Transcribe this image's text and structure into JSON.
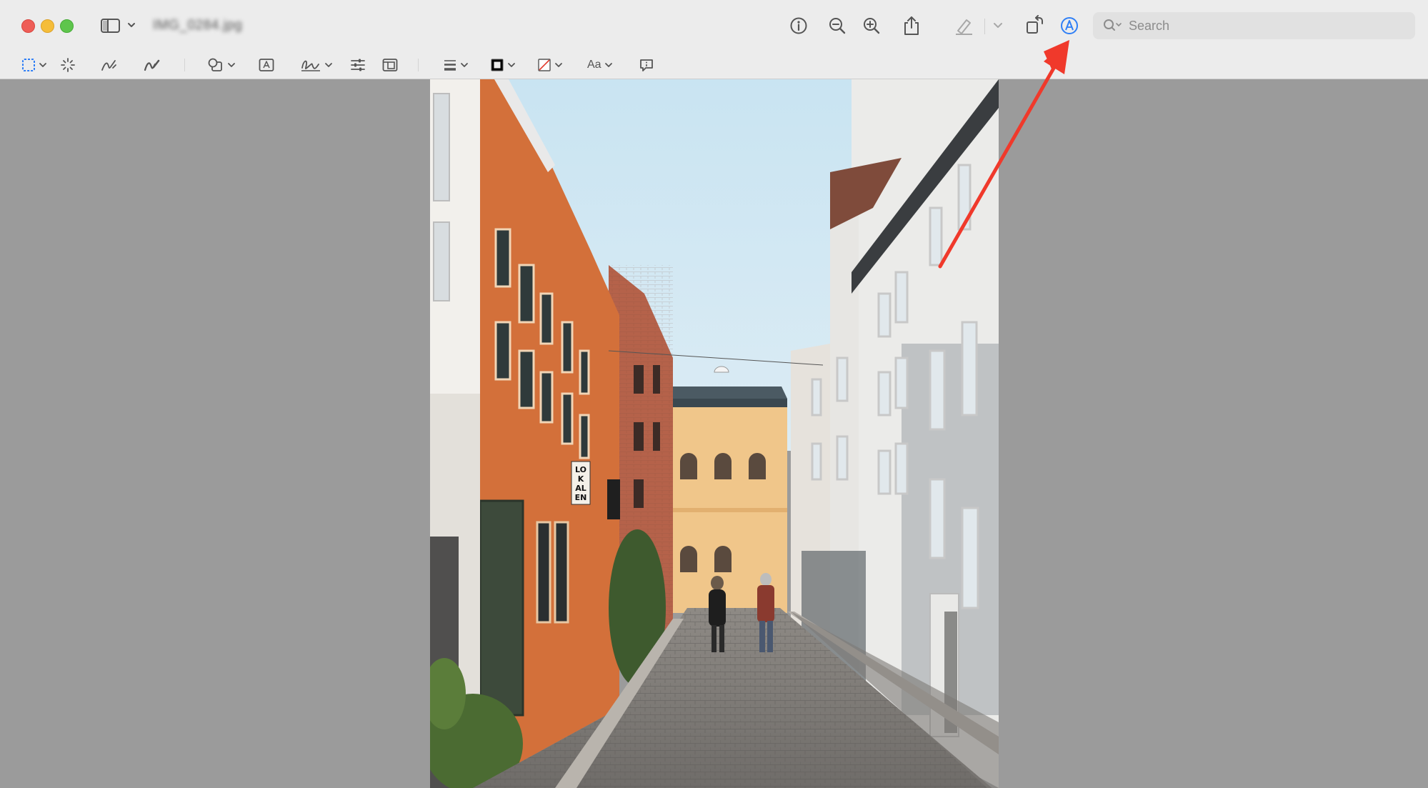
{
  "window": {
    "document_title": "IMG_0284.jpg"
  },
  "toolbar": {
    "search_placeholder": "Search",
    "markup_active_color": "#2f7ff6"
  },
  "markup_toolbar": {
    "text_style_label": "Aa"
  },
  "photo": {
    "sign_text": "LOK AL EN"
  },
  "annotation": {
    "arrow_color": "#f0392b",
    "points_to": "markup-button"
  }
}
